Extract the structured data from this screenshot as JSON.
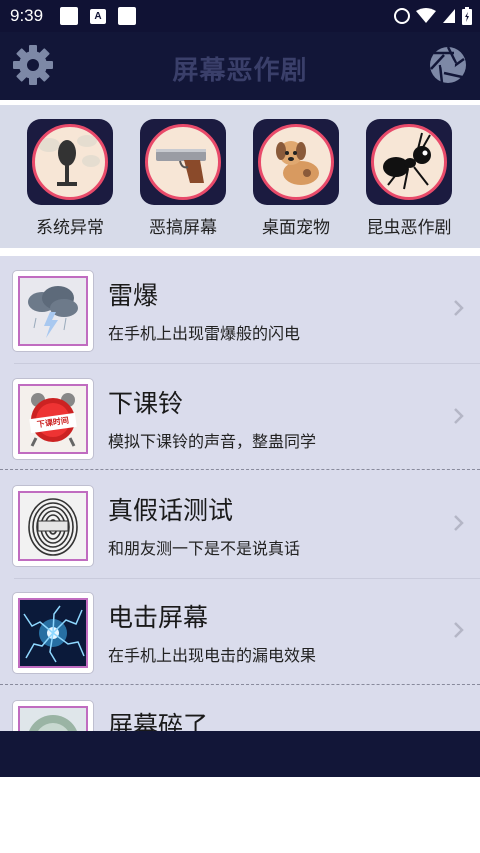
{
  "status_bar": {
    "time": "9:39",
    "notification_letter": "A"
  },
  "header": {
    "title": "屏幕恶作剧",
    "title_color": "#3a3f6a",
    "background": "#121638"
  },
  "categories": [
    {
      "label": "系统异常",
      "icon": "microphone-icon"
    },
    {
      "label": "恶搞屏幕",
      "icon": "pistol-icon"
    },
    {
      "label": "桌面宠物",
      "icon": "dog-icon"
    },
    {
      "label": "昆虫恶作剧",
      "icon": "ant-icon"
    }
  ],
  "list": {
    "items": [
      {
        "title": "雷爆",
        "subtitle": "在手机上出现雷爆般的闪电",
        "icon": "thunder-cloud-icon"
      },
      {
        "title": "下课铃",
        "subtitle": "模拟下课铃的声音，整蛊同学",
        "icon": "alarm-clock-icon",
        "badge": "下课时间"
      },
      {
        "title": "真假话测试",
        "subtitle": "和朋友测一下是不是说真话",
        "icon": "fingerprint-icon"
      },
      {
        "title": "电击屏幕",
        "subtitle": "在手机上出现电击的漏电效果",
        "icon": "electric-shock-icon"
      },
      {
        "title": "屏幕碎了",
        "subtitle": "",
        "icon": "broken-screen-icon"
      }
    ]
  },
  "colors": {
    "accent_ring": "#e84a6a",
    "list_background": "#dadcec",
    "strip_background": "#d7dbe9"
  }
}
